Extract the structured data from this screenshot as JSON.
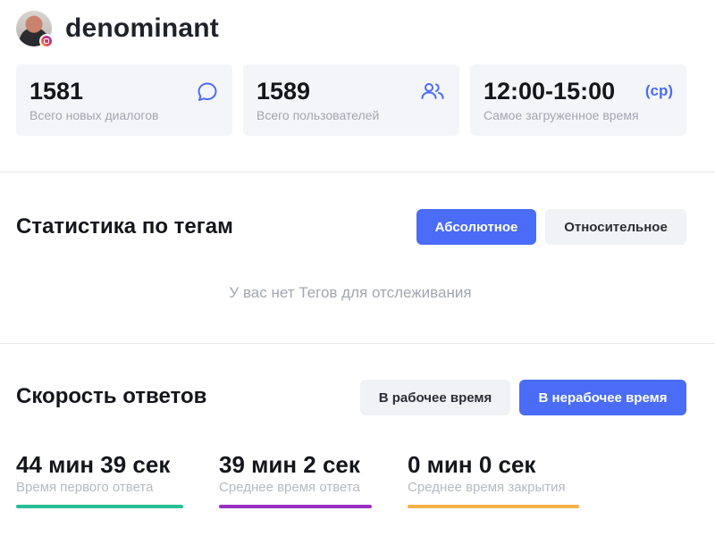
{
  "header": {
    "account_name": "denominant"
  },
  "stats": [
    {
      "value": "1581",
      "label": "Всего новых диалогов",
      "icon": "chat-bubble-icon"
    },
    {
      "value": "1589",
      "label": "Всего пользователей",
      "icon": "users-icon"
    },
    {
      "value": "12:00-15:00",
      "label": "Самое загруженное время",
      "suffix": "(ср)"
    }
  ],
  "tags_section": {
    "title": "Статистика по тегам",
    "absolute_label": "Абсолютное",
    "relative_label": "Относительное",
    "active": "absolute",
    "empty_text": "У вас нет Тегов для отслеживания"
  },
  "speed_section": {
    "title": "Скорость ответов",
    "work_time_label": "В рабочее время",
    "off_time_label": "В нерабочее время",
    "active": "off_time",
    "metrics": [
      {
        "value": "44 мин 39 сек",
        "label": "Время первого ответа",
        "color": "#26bf94"
      },
      {
        "value": "39 мин 2 сек",
        "label": "Среднее время ответа",
        "color": "#9a2fc4"
      },
      {
        "value": "0 мин 0 сек",
        "label": "Среднее время закрытия",
        "color": "#f4b14a"
      }
    ]
  },
  "colors": {
    "accent": "#4a6cf7",
    "card_bg": "#f4f5f9",
    "muted_text": "#a2a6b0"
  }
}
